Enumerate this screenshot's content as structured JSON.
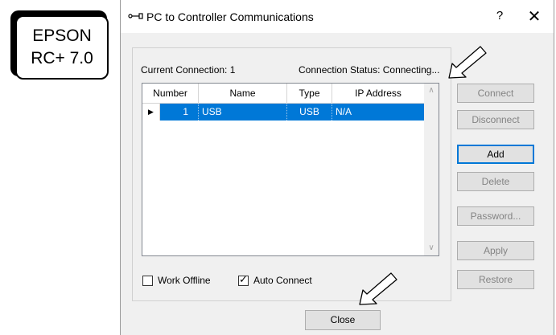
{
  "label": {
    "line1": "EPSON",
    "line2": "RC+ 7.0"
  },
  "dialog": {
    "title": "PC to Controller Communications",
    "help": "?",
    "close_x": "✕",
    "current_connection": "Current Connection: 1",
    "connection_status": "Connection Status: Connecting..."
  },
  "grid": {
    "columns": [
      "Number",
      "Name",
      "Type",
      "IP Address"
    ],
    "rows": [
      {
        "number": "1",
        "name": "USB",
        "type": "USB",
        "ip": "N/A",
        "selected": true
      }
    ]
  },
  "buttons": {
    "connect": "Connect",
    "disconnect": "Disconnect",
    "add": "Add",
    "delete": "Delete",
    "password": "Password...",
    "apply": "Apply",
    "restore": "Restore",
    "close": "Close"
  },
  "checkboxes": {
    "work_offline": {
      "label": "Work Offline",
      "checked": false
    },
    "auto_connect": {
      "label": "Auto Connect",
      "checked": true
    }
  },
  "colors": {
    "selection": "#0078d7",
    "dialog_bg": "#f0f0f0",
    "disabled_text": "#838383"
  }
}
